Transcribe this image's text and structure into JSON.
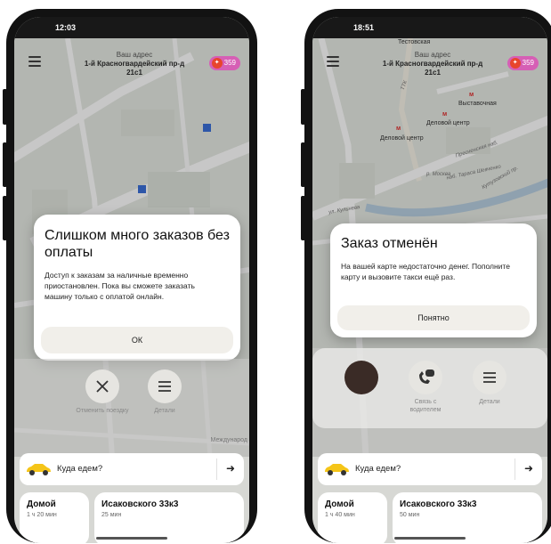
{
  "left": {
    "status_time": "12:03",
    "address_label": "Ваш адрес",
    "address_main": "1-й Красногвардейский пр-д",
    "address_sub": "21с1",
    "badge_value": "359",
    "dialog": {
      "title": "Слишком много заказов без оплаты",
      "body": "Доступ к заказам за наличные временно приостановлен. Пока вы сможете заказать машину только с оплатой онлайн.",
      "button": "ОК"
    },
    "actions": [
      {
        "label": "Отменить поездку",
        "icon": "close-icon"
      },
      {
        "label": "Детали",
        "icon": "menu-lines-icon"
      }
    ],
    "map_label_right": "Международ",
    "search_placeholder": "Куда едем?",
    "favorites": [
      {
        "title": "Домой",
        "subtitle": "1 ч 20 мин"
      },
      {
        "title": "Исаковского 33к3",
        "subtitle": "25 мин"
      }
    ]
  },
  "right": {
    "status_time": "18:51",
    "address_label": "Ваш адрес",
    "address_main": "1-й Красногвардейский пр-д",
    "address_sub": "21с1",
    "badge_value": "359",
    "map_labels": {
      "top": "Тестовская",
      "ttk": "ТТК",
      "metro_vystavochnaya": "Выставочная",
      "metro_delovoy_1": "Деловой центр",
      "metro_delovoy_2": "Деловой центр",
      "street_presnenskaya": "Пресненская наб.",
      "street_kutuzovsky": "Кутузовский пр.",
      "street_kulneva": "ул. Кульнева",
      "street_moskva": "р. Москва",
      "street_tarasa": "наб. Тараса Шевченко"
    },
    "dialog": {
      "title": "Заказ отменён",
      "body": "На вашей карте недостаточно денег. Пополните карту и вызовите такси ещё раз.",
      "button": "Понятно"
    },
    "actions": [
      {
        "label": "",
        "icon": "driver-avatar"
      },
      {
        "label": "Связь с водителем",
        "icon": "phone-chat-icon"
      },
      {
        "label": "Детали",
        "icon": "menu-lines-icon"
      }
    ],
    "search_placeholder": "Куда едем?",
    "favorites": [
      {
        "title": "Домой",
        "subtitle": "1 ч 40 мин"
      },
      {
        "title": "Исаковского 33к3",
        "subtitle": "50 мин"
      }
    ]
  },
  "colors": {
    "badge": "#d65fb5",
    "metro": "#e03030",
    "taxi_yellow": "#f5c518",
    "dialog_button": "#f1efea"
  }
}
